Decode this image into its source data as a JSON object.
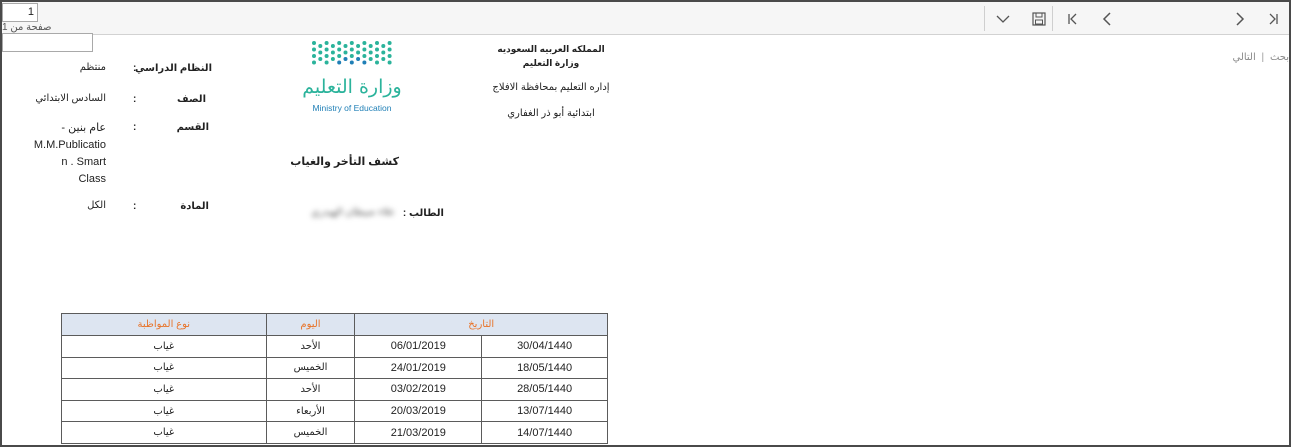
{
  "toolbar": {
    "page_current": "1",
    "page_of": "صفحة من 1",
    "search_value": "",
    "search_label": "بحث",
    "next_label": "التالي",
    "separator": "|"
  },
  "header": {
    "kingdom": "المملكه العربيه السعوديه",
    "ministry": "وزارة التعليم",
    "directorate": "إداره التعليم بمحافظة الافلاج",
    "school": "ابتدائية أبو ذر الغفاري",
    "logo_ar": "وزارة التعليم",
    "logo_en": "Ministry of Education"
  },
  "report": {
    "title": "كشف التأخر والغياب",
    "student_label": "الطالب",
    "student_name": "علاء صيطان الهيدري",
    "colon": ":"
  },
  "info": {
    "system_label": "النظام الدراسي",
    "system_value": "منتظم",
    "grade_label": "الصف",
    "grade_value": "السادس الابتدائي",
    "section_label": "القسم",
    "section_value_1": "عام بنين -",
    "section_value_2": "M.M.Publicatio",
    "section_value_3": "n . Smart",
    "section_value_4": "Class",
    "subject_label": "المادة",
    "subject_value": "الكل"
  },
  "table": {
    "headers": {
      "date": "التاريخ",
      "day": "اليوم",
      "type": "نوع المواظبة"
    },
    "rows": [
      {
        "hijri": "30/04/1440",
        "greg": "06/01/2019",
        "day": "الأحد",
        "type": "غياب"
      },
      {
        "hijri": "18/05/1440",
        "greg": "24/01/2019",
        "day": "الخميس",
        "type": "غياب"
      },
      {
        "hijri": "28/05/1440",
        "greg": "03/02/2019",
        "day": "الأحد",
        "type": "غياب"
      },
      {
        "hijri": "13/07/1440",
        "greg": "20/03/2019",
        "day": "الأربعاء",
        "type": "غياب"
      },
      {
        "hijri": "14/07/1440",
        "greg": "21/03/2019",
        "day": "الخميس",
        "type": "غياب"
      }
    ]
  },
  "colors": {
    "logo_green": "#2bb39b",
    "logo_blue": "#1f7fb6",
    "header_fill": "#dde5f1",
    "header_text": "#e8742a"
  }
}
